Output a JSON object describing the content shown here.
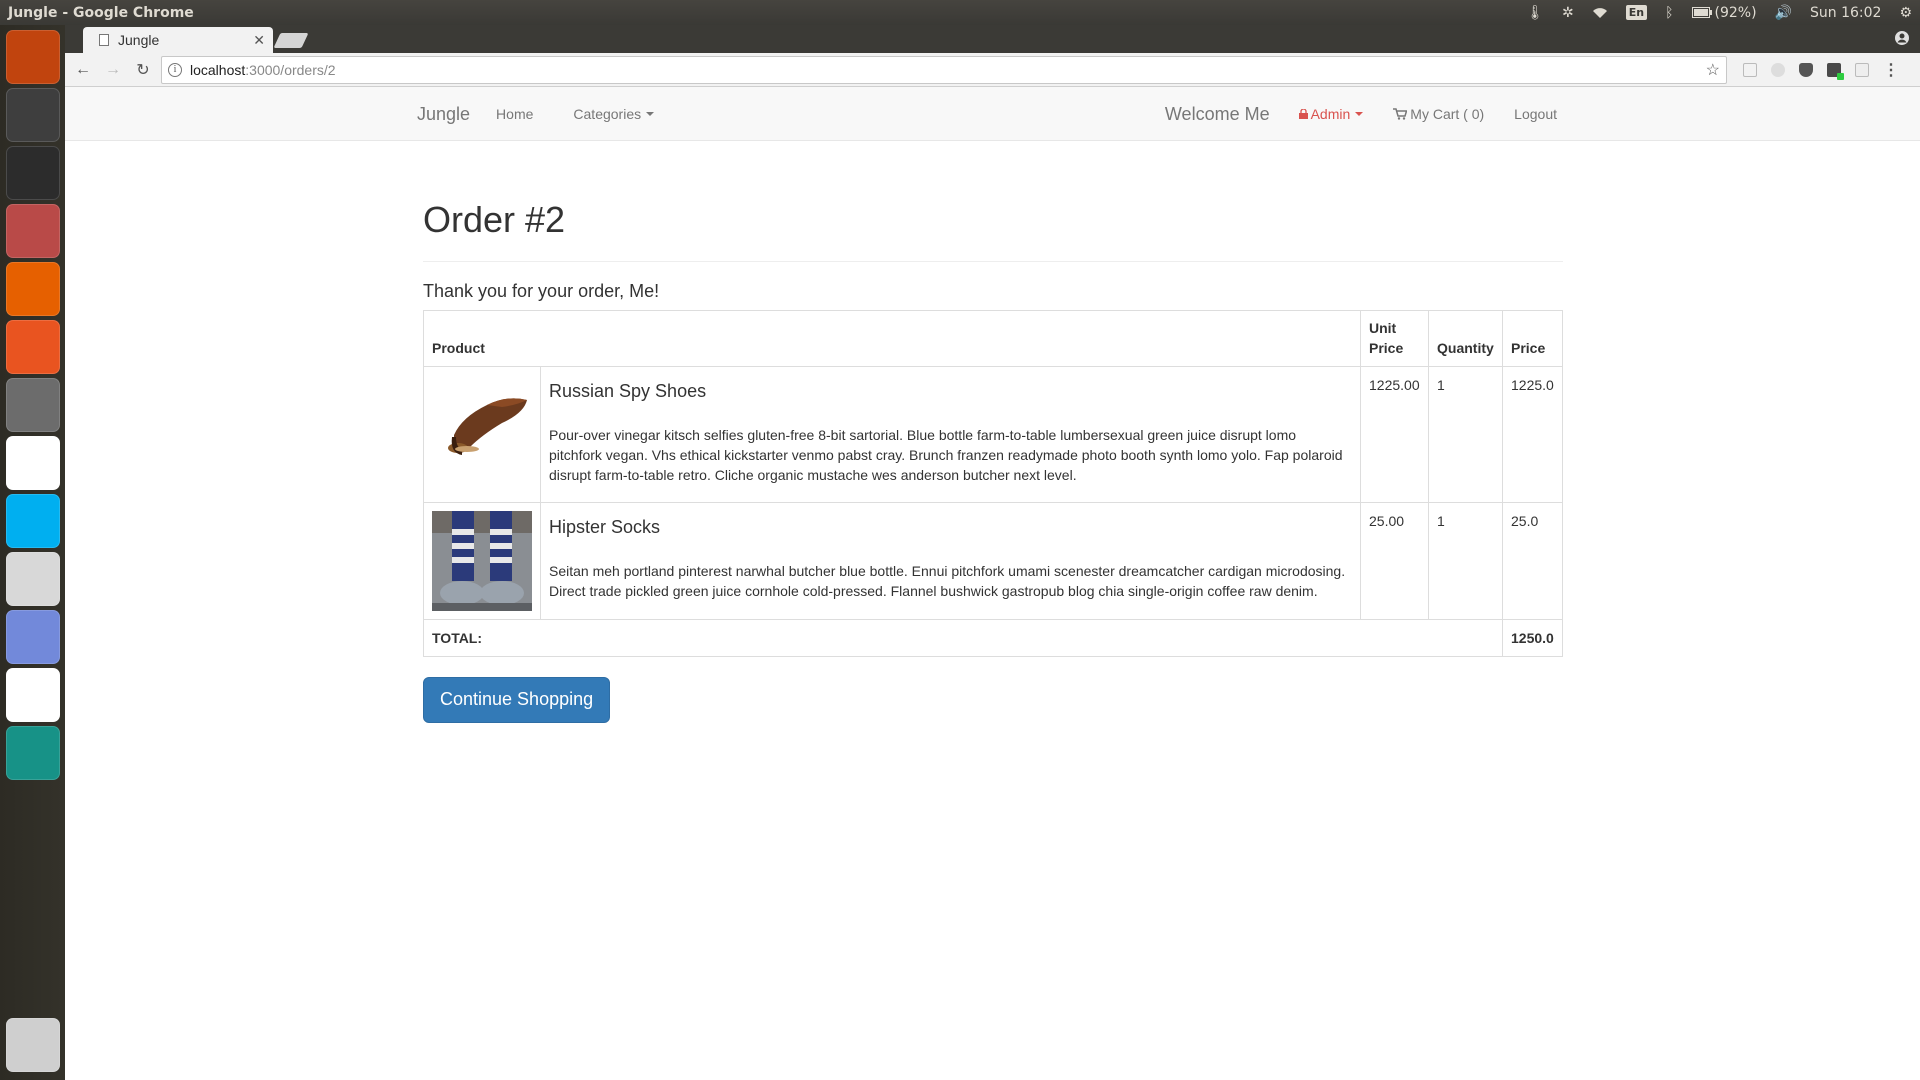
{
  "os_panel": {
    "window_title": "Jungle - Google Chrome",
    "battery": "(92%)",
    "clock": "Sun 16:02",
    "lang": "En"
  },
  "launcher": {
    "items": [
      {
        "name": "ubuntu-dash-icon",
        "color": "#c1440e"
      },
      {
        "name": "sublime-text-icon",
        "color": "#3e3e3e"
      },
      {
        "name": "terminal-icon",
        "color": "#2c2c2c"
      },
      {
        "name": "files-icon",
        "color": "#b94a48"
      },
      {
        "name": "firefox-icon",
        "color": "#e66000"
      },
      {
        "name": "software-center-icon",
        "color": "#e95420"
      },
      {
        "name": "system-settings-icon",
        "color": "#6c6c6c"
      },
      {
        "name": "slack-icon",
        "color": "#ffffff"
      },
      {
        "name": "skype-icon",
        "color": "#00aff0"
      },
      {
        "name": "mail-icon",
        "color": "#d8d8d8"
      },
      {
        "name": "discord-icon",
        "color": "#7289da"
      },
      {
        "name": "chrome-icon",
        "color": "#ffffff"
      },
      {
        "name": "gitkraken-icon",
        "color": "#179287"
      }
    ]
  },
  "browser": {
    "tab_title": "Jungle",
    "url_host": "localhost",
    "url_path": ":3000/orders/2"
  },
  "navbar": {
    "brand": "Jungle",
    "home": "Home",
    "categories": "Categories",
    "welcome": "Welcome Me",
    "admin": "Admin",
    "cart": "My Cart ( 0)",
    "logout": "Logout"
  },
  "order": {
    "title": "Order #2",
    "thanks": "Thank you for your order, Me!",
    "columns": {
      "product": "Product",
      "unit_price": "Unit Price",
      "quantity": "Quantity",
      "price": "Price"
    },
    "items": [
      {
        "name": "Russian Spy Shoes",
        "description": "Pour-over vinegar kitsch selfies gluten-free 8-bit sartorial. Blue bottle farm-to-table lumbersexual green juice disrupt lomo pitchfork vegan. Vhs ethical kickstarter venmo pabst cray. Brunch franzen readymade photo booth synth lomo yolo. Fap polaroid disrupt farm-to-table retro. Cliche organic mustache wes anderson butcher next level.",
        "unit_price": "1225.00",
        "quantity": "1",
        "price": "1225.0"
      },
      {
        "name": "Hipster Socks",
        "description": "Seitan meh portland pinterest narwhal butcher blue bottle. Ennui pitchfork umami scenester dreamcatcher cardigan microdosing. Direct trade pickled green juice cornhole cold-pressed. Flannel bushwick gastropub blog chia single-origin coffee raw denim.",
        "unit_price": "25.00",
        "quantity": "1",
        "price": "25.0"
      }
    ],
    "total_label": "TOTAL:",
    "total_value": "1250.0",
    "continue_button": "Continue Shopping"
  }
}
